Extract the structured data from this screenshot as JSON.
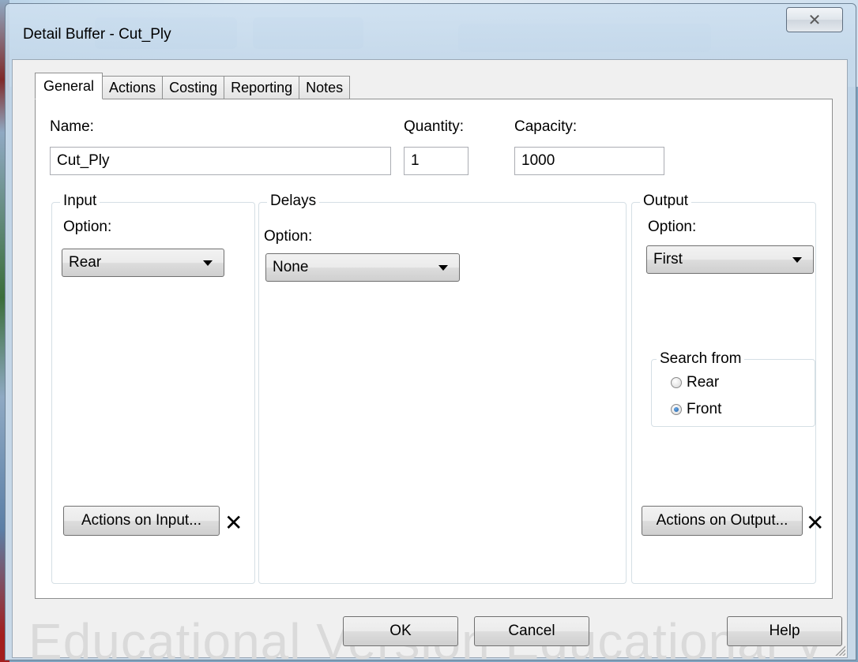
{
  "window": {
    "title": "Detail Buffer - Cut_Ply",
    "close_glyph": "✕",
    "watermark": "Educational Version  Educational V"
  },
  "tabs": [
    {
      "label": "General",
      "active": true
    },
    {
      "label": "Actions",
      "active": false
    },
    {
      "label": "Costing",
      "active": false
    },
    {
      "label": "Reporting",
      "active": false
    },
    {
      "label": "Notes",
      "active": false
    }
  ],
  "general": {
    "name_label": "Name:",
    "name_value": "Cut_Ply",
    "quantity_label": "Quantity:",
    "quantity_value": "1",
    "capacity_label": "Capacity:",
    "capacity_value": "1000"
  },
  "input_group": {
    "title": "Input",
    "option_label": "Option:",
    "option_value": "Rear",
    "actions_button": "Actions on Input...",
    "clear_glyph": "✕"
  },
  "delays_group": {
    "title": "Delays",
    "option_label": "Option:",
    "option_value": "None"
  },
  "output_group": {
    "title": "Output",
    "option_label": "Option:",
    "option_value": "First",
    "search_from": {
      "title": "Search from",
      "options": [
        {
          "label": "Rear",
          "checked": false
        },
        {
          "label": "Front",
          "checked": true
        }
      ]
    },
    "actions_button": "Actions on Output...",
    "clear_glyph": "✕"
  },
  "footer": {
    "ok": "OK",
    "cancel": "Cancel",
    "help": "Help"
  }
}
